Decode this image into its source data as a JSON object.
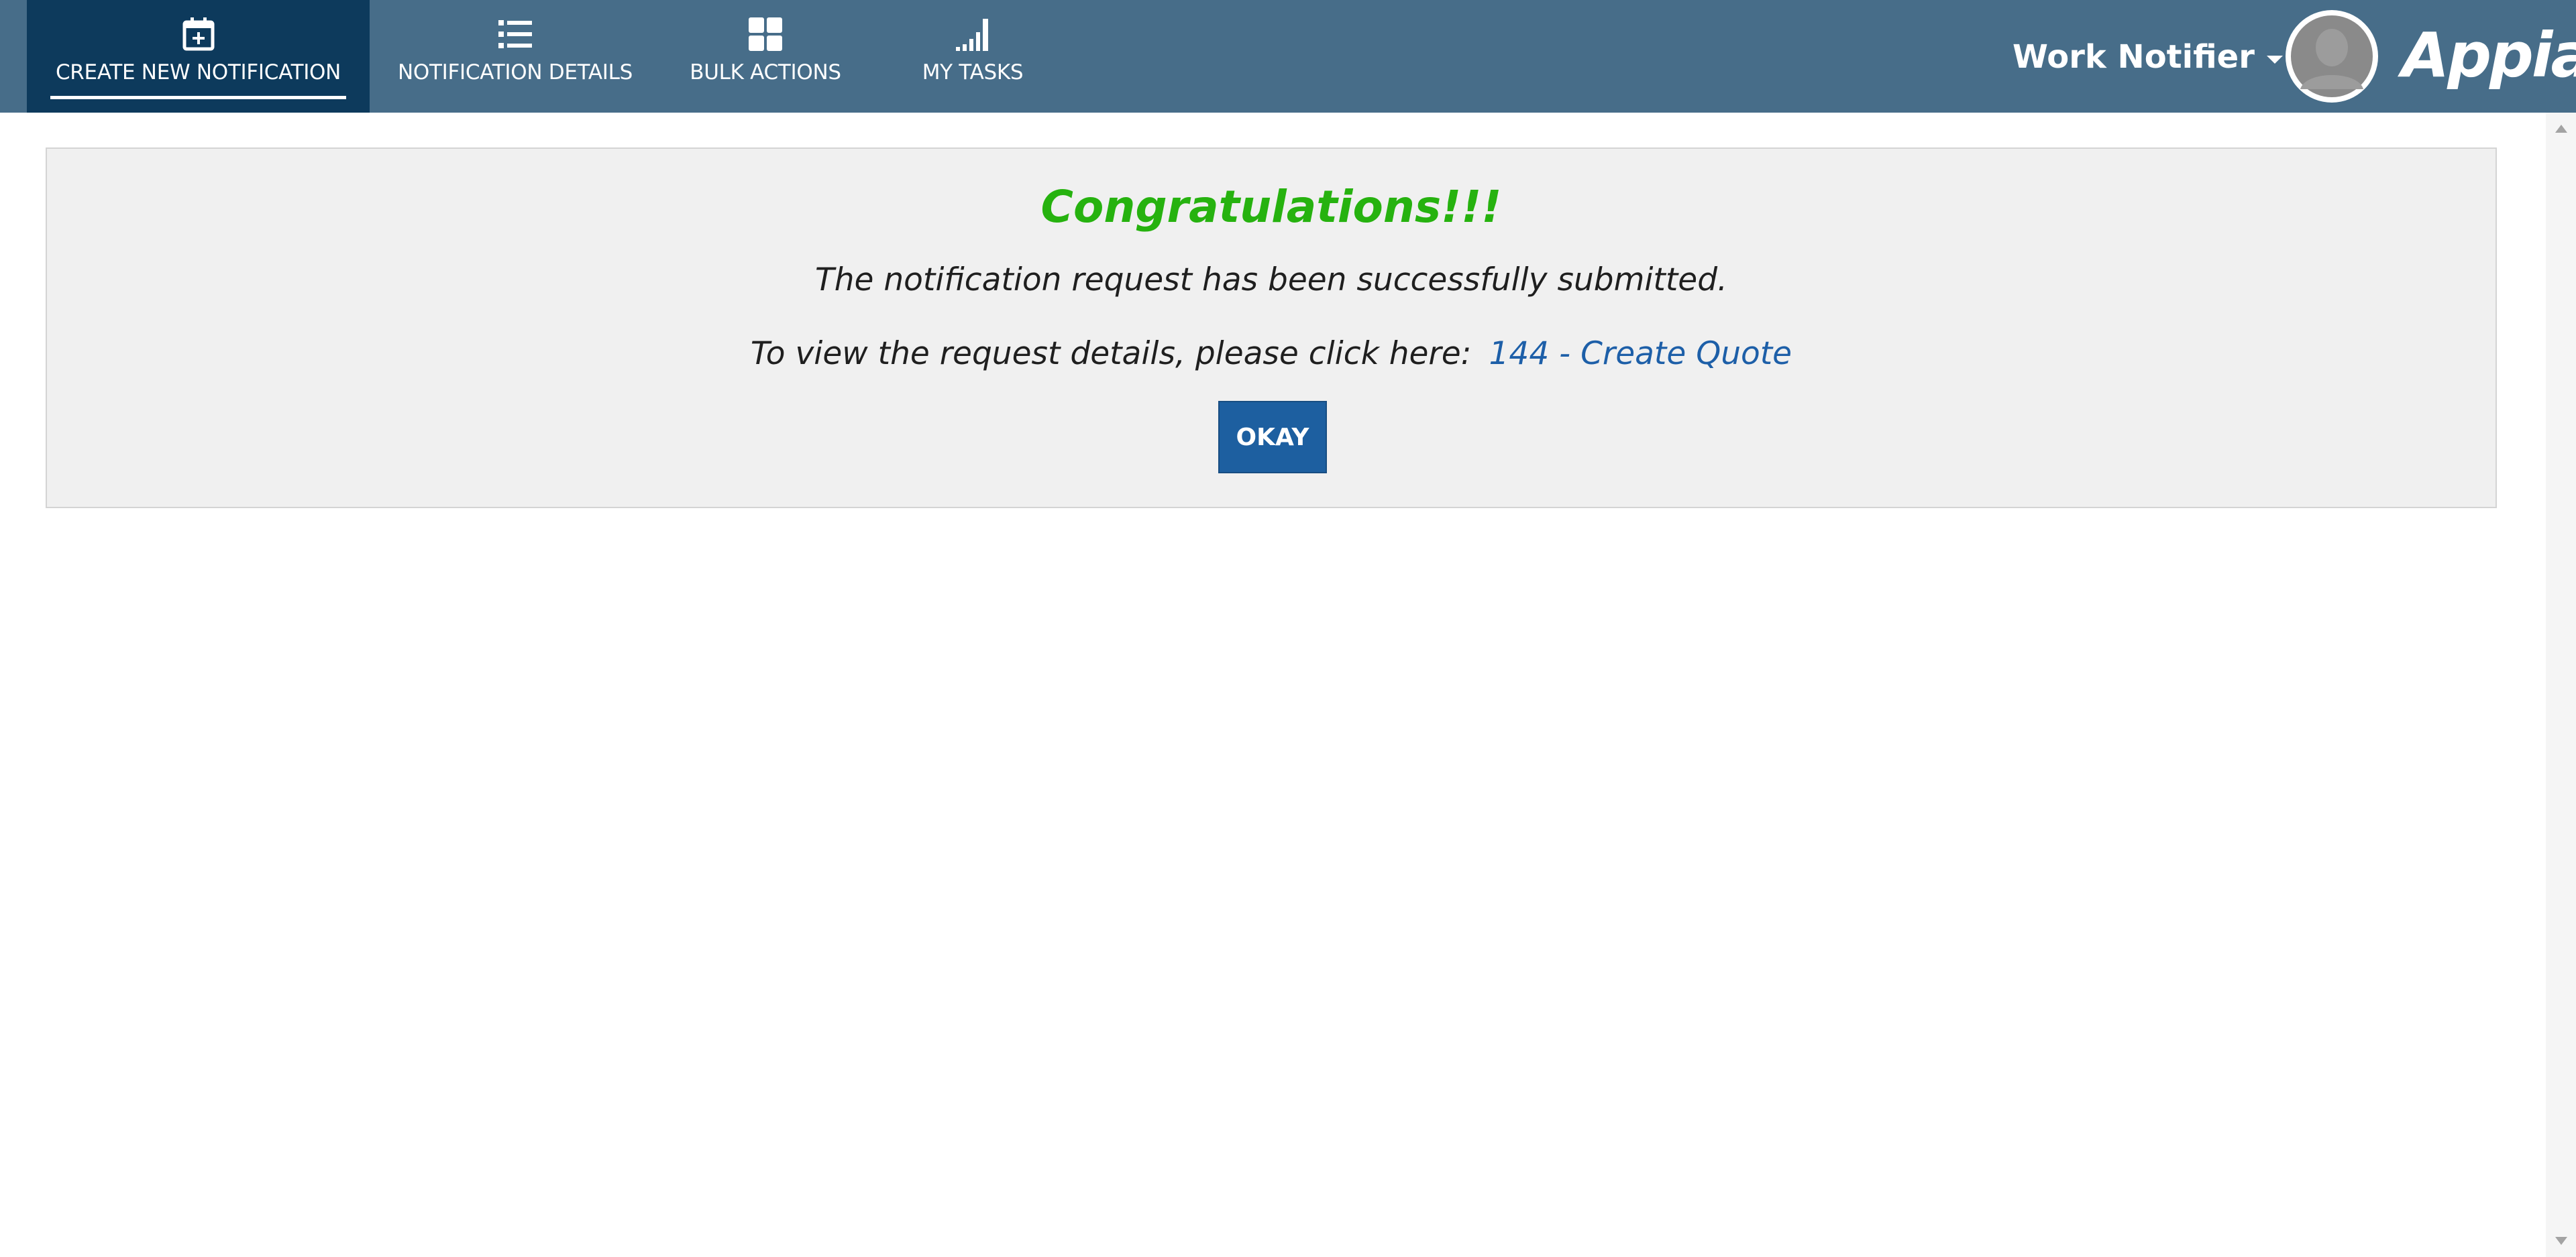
{
  "nav": {
    "tabs": [
      {
        "label": "CREATE NEW NOTIFICATION",
        "icon": "calendar-plus-icon",
        "active": true
      },
      {
        "label": "NOTIFICATION DETAILS",
        "icon": "list-icon",
        "active": false
      },
      {
        "label": "BULK ACTIONS",
        "icon": "grid-icon",
        "active": false
      },
      {
        "label": "MY TASKS",
        "icon": "signal-bars-icon",
        "active": false
      }
    ]
  },
  "header": {
    "user_menu_label": "Work Notifier",
    "logo_text": "Appian"
  },
  "main": {
    "heading": "Congratulations!!!",
    "message": "The notification request has been successfully submitted.",
    "view_prompt": "To view the request details, please click here:",
    "request_link": "144 - Create Quote",
    "okay_label": "OKAY"
  },
  "colors": {
    "header_bg": "#476d89",
    "active_tab_bg": "#0d3a5c",
    "heading_green": "#26b20f",
    "link_blue": "#1d5fa8",
    "button_blue": "#1d5fa0",
    "panel_bg": "#f0f0f0"
  }
}
